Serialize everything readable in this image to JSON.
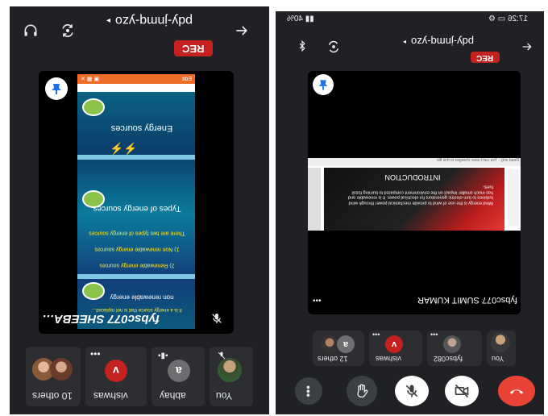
{
  "left": {
    "meeting_code": "pdy-jnmq-yzo",
    "rec": "REC",
    "presenter_label": "fybsc077 SHEEBA…",
    "slide": {
      "toolbar_text": "Edit",
      "block1": "Energy sources",
      "block2_title": "Types of energy sources",
      "block2_line1": "There are two types of energy sources",
      "block2_line2": "1) Non renewable energy sources",
      "block2_line3": "2) Renewable energy sources",
      "block3_title": "non renewable energy",
      "block3_line": "It is a energy source that is not replaced..."
    },
    "participants": [
      {
        "name": "You",
        "type": "photo"
      },
      {
        "name": "abhay",
        "initial": "a",
        "color": "#6d6e70"
      },
      {
        "name": "vishwas",
        "initial": "v",
        "color": "#c5221f"
      },
      {
        "name": "10 others",
        "type": "group"
      }
    ]
  },
  "right": {
    "status_time": "17:26",
    "status_battery": "40%",
    "meeting_code": "pdy-jnmq-yzo",
    "rec": "REC",
    "presenter_label": "fybsc077 SUMIT KUMAR",
    "slide": {
      "notice": "Read only - You can't save changes to this file",
      "title": "INTRODUCTION",
      "body": "Wind energy is the use of wind to provide mechanical power through wind turbines to turn electric generators for electrical power. It is renewable and has much smaller impact on the environment compared to burning fossil fuels."
    },
    "participants": [
      {
        "name": "You",
        "type": "photo"
      },
      {
        "name": "fybsc082",
        "type": "photo"
      },
      {
        "name": "vishwas",
        "initial": "v",
        "color": "#c5221f"
      },
      {
        "name": "12 others",
        "type": "group",
        "initial": "a"
      }
    ]
  },
  "colors": {
    "end_call": "#ea4335",
    "rec": "#c5221f",
    "bg": "#202124"
  }
}
